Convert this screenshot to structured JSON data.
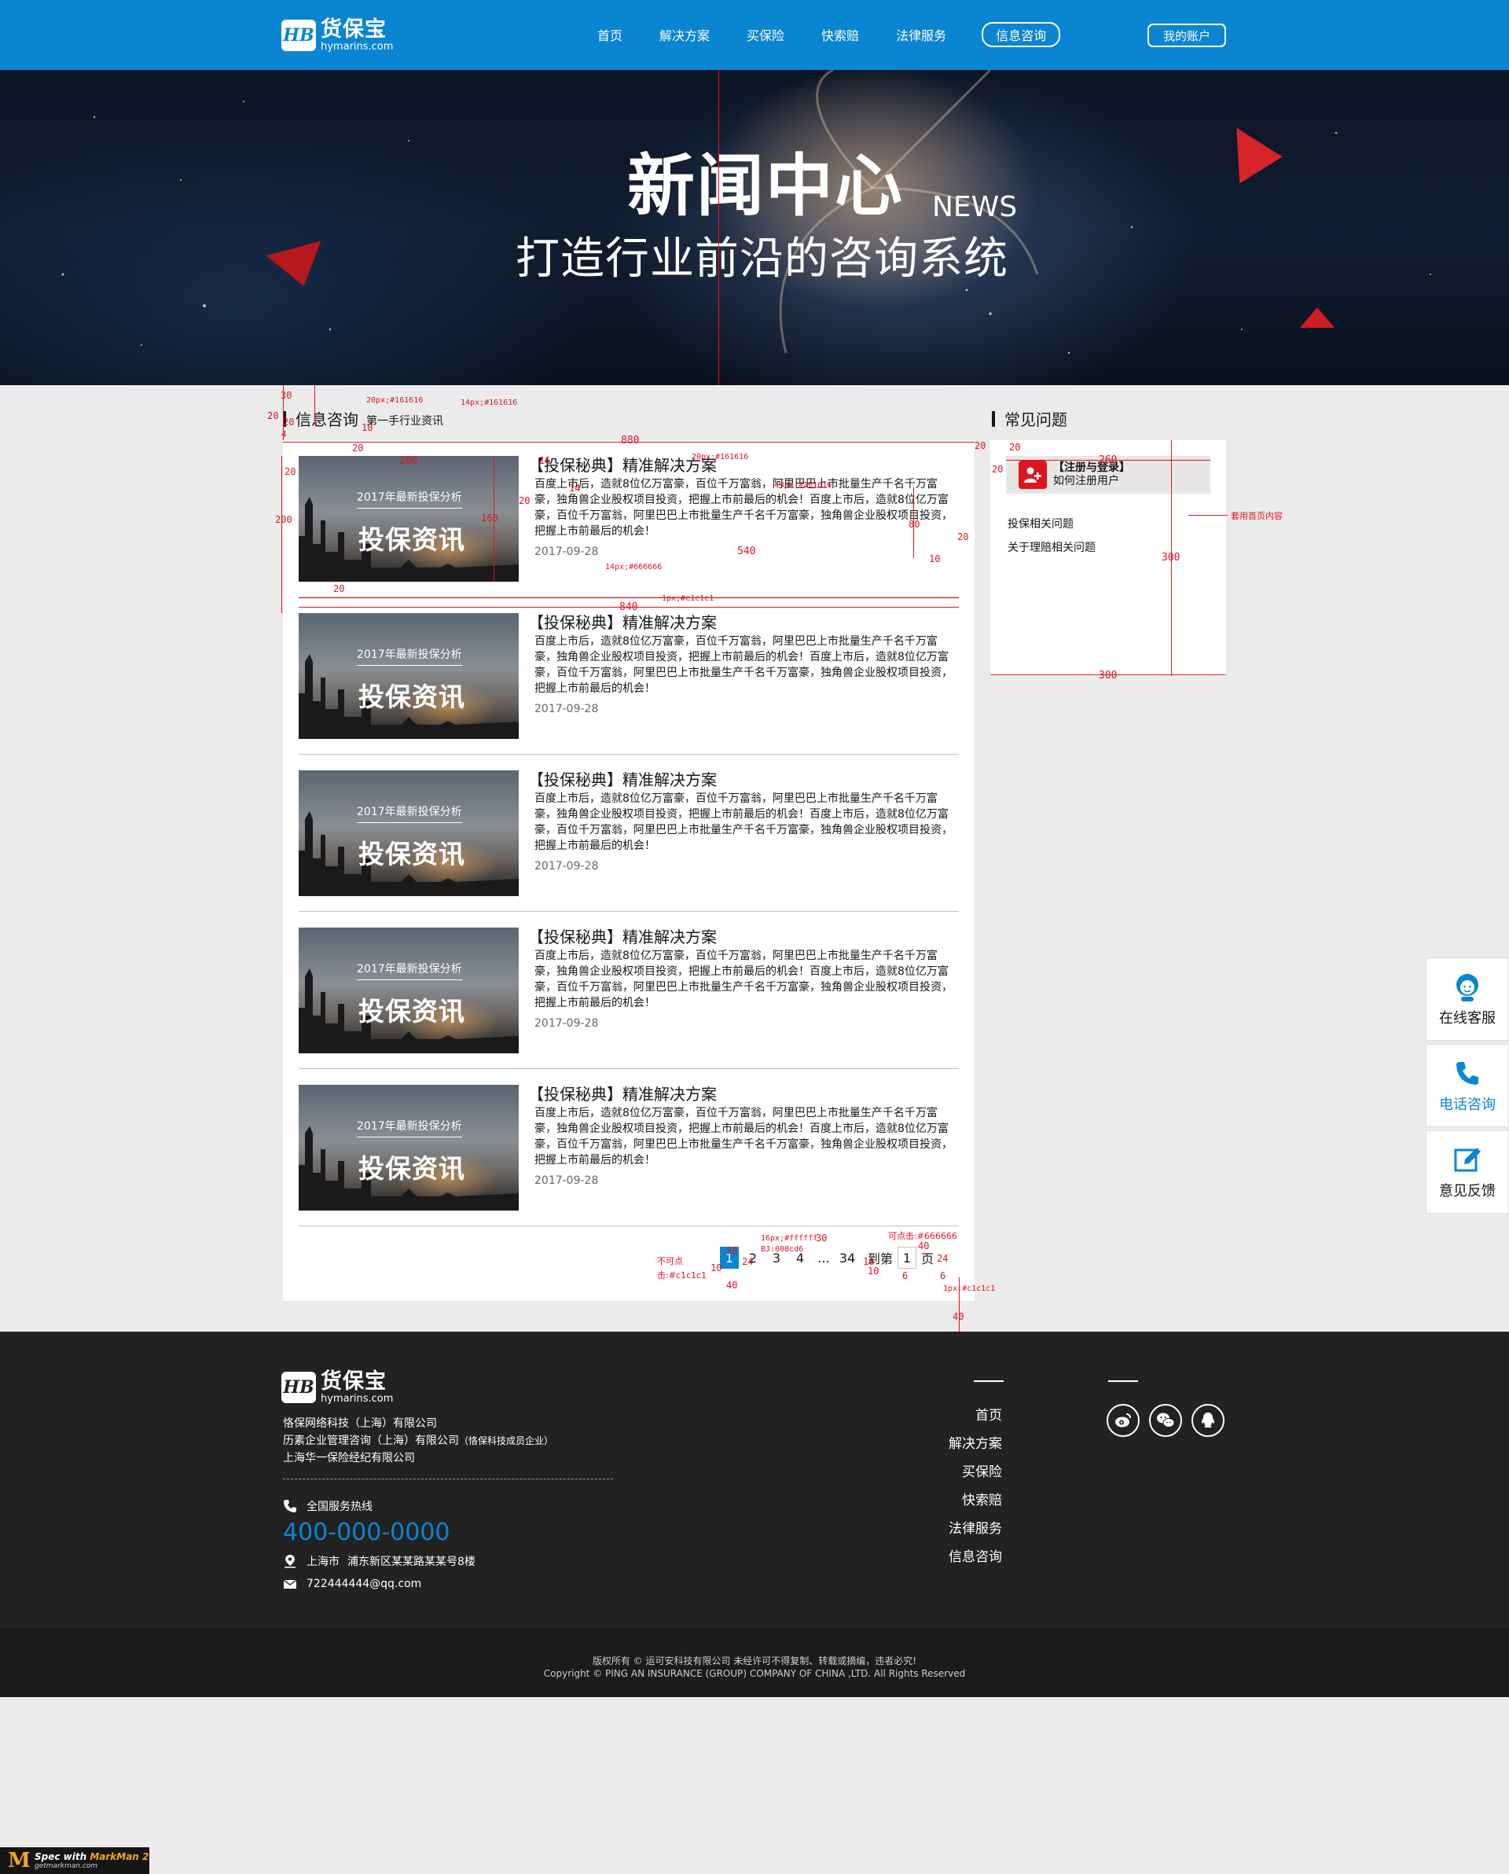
{
  "header": {
    "logo_badge": "HB",
    "logo_cn": "货保宝",
    "logo_en": "hymarins.com",
    "nav": [
      "首页",
      "解决方案",
      "买保险",
      "快索赔",
      "法律服务",
      "信息咨询"
    ],
    "account": "我的账户"
  },
  "banner": {
    "title": "新闻中心",
    "title_en": "NEWS",
    "subtitle": "打造行业前沿的咨询系统"
  },
  "news_section": {
    "title": "信息咨询",
    "subtitle": "第一手行业资讯",
    "thumb_small": "2017年最新投保分析",
    "thumb_big": "投保资讯",
    "items": [
      {
        "title": "【投保秘典】精准解决方案",
        "desc": "百度上市后，造就8位亿万富豪，百位千万富翁，阿里巴巴上市批量生产千名千万富豪，独角兽企业股权项目投资，把握上市前最后的机会！百度上市后，造就8位亿万富豪，百位千万富翁，阿里巴巴上市批量生产千名千万富豪，独角兽企业股权项目投资，把握上市前最后的机会！",
        "date": "2017-09-28"
      },
      {
        "title": "【投保秘典】精准解决方案",
        "desc": "百度上市后，造就8位亿万富豪，百位千万富翁，阿里巴巴上市批量生产千名千万富豪，独角兽企业股权项目投资，把握上市前最后的机会！百度上市后，造就8位亿万富豪，百位千万富翁，阿里巴巴上市批量生产千名千万富豪，独角兽企业股权项目投资，把握上市前最后的机会！",
        "date": "2017-09-28"
      },
      {
        "title": "【投保秘典】精准解决方案",
        "desc": "百度上市后，造就8位亿万富豪，百位千万富翁，阿里巴巴上市批量生产千名千万富豪，独角兽企业股权项目投资，把握上市前最后的机会！百度上市后，造就8位亿万富豪，百位千万富翁，阿里巴巴上市批量生产千名千万富豪，独角兽企业股权项目投资，把握上市前最后的机会！",
        "date": "2017-09-28"
      },
      {
        "title": "【投保秘典】精准解决方案",
        "desc": "百度上市后，造就8位亿万富豪，百位千万富翁，阿里巴巴上市批量生产千名千万富豪，独角兽企业股权项目投资，把握上市前最后的机会！百度上市后，造就8位亿万富豪，百位千万富翁，阿里巴巴上市批量生产千名千万富豪，独角兽企业股权项目投资，把握上市前最后的机会！",
        "date": "2017-09-28"
      },
      {
        "title": "【投保秘典】精准解决方案",
        "desc": "百度上市后，造就8位亿万富豪，百位千万富翁，阿里巴巴上市批量生产千名千万富豪，独角兽企业股权项目投资，把握上市前最后的机会！百度上市后，造就8位亿万富豪，百位千万富翁，阿里巴巴上市批量生产千名千万富豪，独角兽企业股权项目投资，把握上市前最后的机会！",
        "date": "2017-09-28"
      }
    ]
  },
  "pagination": {
    "pages": [
      "1",
      "2",
      "3",
      "4",
      "...",
      "34"
    ],
    "current": "1",
    "goto_prefix": "到第",
    "goto_value": "1",
    "goto_suffix": "页"
  },
  "faq": {
    "title": "常见问题",
    "register_title": "【注册与登录】",
    "register_sub": "如何注册用户",
    "links": [
      "投保相关问题",
      "关于理赔相关问题"
    ]
  },
  "float_tools": [
    "在线客服",
    "电话咨询",
    "意见反馈"
  ],
  "footer": {
    "logo_cn": "货保宝",
    "logo_en": "hymarins.com",
    "companies": [
      "恪保网络科技（上海）有限公司",
      "历素企业管理咨询（上海）有限公司",
      "上海华一保险经纪有限公司"
    ],
    "company2_note": "（恪保科技成员企业）",
    "hotline_label": "全国服务热线",
    "hotline": "400-000-0000",
    "address_city": "上海市",
    "address": "浦东新区某某路某某号8楼",
    "email": "722444444@qq.com",
    "nav": [
      "首页",
      "解决方案",
      "买保险",
      "快索赔",
      "法律服务",
      "信息咨询"
    ],
    "copyright_cn": "版权所有 © 运可安科技有限公司 未经许可不得复制、转载或摘编，违者必究!",
    "copyright_en": "Copyright © PING AN INSURANCE (GROUP) COMPANY OF CHINA ,LTD. All Rights Reserved"
  },
  "annotations": {
    "a30": "30",
    "a20": "20",
    "a10": "10",
    "a4": "4",
    "a20px": "20px;#161616",
    "a14px": "14px;#161616",
    "a880": "880",
    "a280": "280",
    "a16": "16",
    "a14": "14",
    "a200": "200",
    "a160": "160",
    "a540": "540",
    "a80": "80",
    "a840": "840",
    "a14px666": "14px;#666666",
    "a1pxc1": "1px;#c1c1c1",
    "a20b": "20",
    "a260": "260",
    "a300": "300",
    "a300b": "300",
    "aHome": "套用首页内容",
    "a40": "40",
    "a24": "24",
    "a6": "6",
    "aDisabled": "不可点击:#c1c1c1",
    "aClickable": "可点击:#666666",
    "a16fff": "16px;#ffffff",
    "aBg": "BJ:008cd6",
    "a28": "28",
    "a1pxc1b": "1px;#c1c1c1"
  },
  "markman": {
    "line1a": "Spec with ",
    "line1b": "MarkMan 2",
    "line2": "getmarkman.com"
  }
}
